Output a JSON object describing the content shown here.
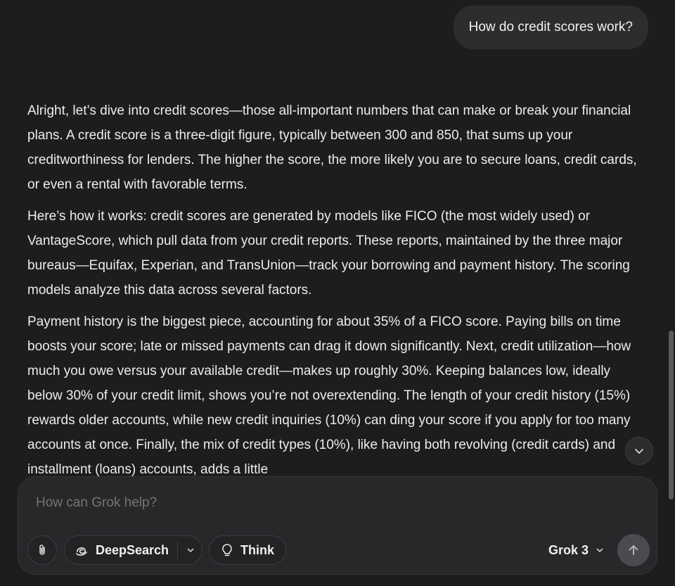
{
  "conversation": {
    "user_message": "How do credit scores work?",
    "response_paragraphs": [
      "Alright, let’s dive into credit scores—those all-important numbers that can make or break your financial plans. A credit score is a three-digit figure, typically between 300 and 850, that sums up your creditworthiness for lenders. The higher the score, the more likely you are to secure loans, credit cards, or even a rental with favorable terms.",
      "Here’s how it works: credit scores are generated by models like FICO (the most widely used) or VantageScore, which pull data from your credit reports. These reports, maintained by the three major bureaus—Equifax, Experian, and TransUnion—track your borrowing and payment history. The scoring models analyze this data across several factors.",
      "Payment history is the biggest piece, accounting for about 35% of a FICO score. Paying bills on time boosts your score; late or missed payments can drag it down significantly. Next, credit utilization—how much you owe versus your available credit—makes up roughly 30%. Keeping balances low, ideally below 30% of your credit limit, shows you’re not overextending. The length of your credit history (15%) rewards older accounts, while new credit inquiries (10%) can ding your score if you apply for too many accounts at once. Finally, the mix of credit types (10%), like having both revolving (credit cards) and installment (loans) accounts, adds a little"
    ]
  },
  "composer": {
    "placeholder": "How can Grok help?",
    "deepsearch_label": "DeepSearch",
    "think_label": "Think",
    "model_label": "Grok 3"
  },
  "icons": {
    "attach": "paperclip-icon",
    "deepsearch": "deepsearch-swirl-icon",
    "think": "lightbulb-icon",
    "send": "arrow-up-icon",
    "scroll_down": "chevron-down-icon"
  },
  "colors": {
    "background": "#1c1d1e",
    "user_bubble": "#2c2d2f",
    "composer": "#27282a",
    "send_button": "#4a4b4e",
    "text": "#ececed",
    "placeholder": "#8d8e91"
  }
}
